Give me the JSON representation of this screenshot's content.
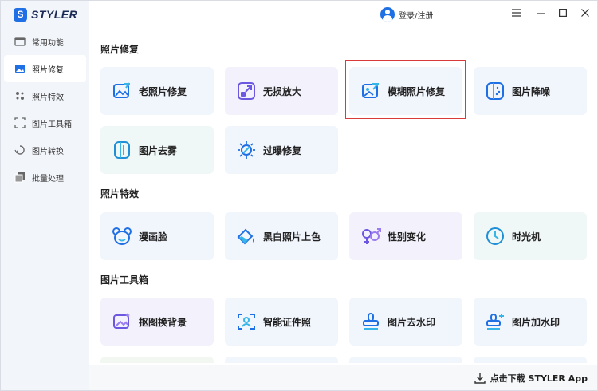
{
  "app": {
    "brand_mark": "S",
    "brand_name": "STYLER"
  },
  "titlebar": {
    "login_label": "登录/注册",
    "controls": [
      {
        "name": "menu-button",
        "glyph": "☰"
      },
      {
        "name": "minimize-button",
        "glyph": "—"
      },
      {
        "name": "maximize-button",
        "glyph": "☐"
      },
      {
        "name": "close-button",
        "glyph": "✕"
      }
    ]
  },
  "sidebar": {
    "items": [
      {
        "label": "常用功能",
        "icon": "window-icon",
        "active": false
      },
      {
        "label": "照片修复",
        "icon": "image-icon",
        "active": true
      },
      {
        "label": "照片特效",
        "icon": "sparkle-icon",
        "active": false
      },
      {
        "label": "图片工具箱",
        "icon": "toolbox-icon",
        "active": false
      },
      {
        "label": "图片转换",
        "icon": "convert-icon",
        "active": false
      },
      {
        "label": "批量处理",
        "icon": "batch-icon",
        "active": false
      }
    ]
  },
  "sections": {
    "repair": {
      "title": "照片修复",
      "cards": [
        {
          "label": "老照片修复",
          "icon": "old-photo-icon"
        },
        {
          "label": "无损放大",
          "icon": "enlarge-icon"
        },
        {
          "label": "模糊照片修复",
          "icon": "blur-repair-icon"
        },
        {
          "label": "图片降噪",
          "icon": "denoise-icon"
        },
        {
          "label": "图片去雾",
          "icon": "dehaze-icon"
        },
        {
          "label": "过曝修复",
          "icon": "overexposure-icon"
        }
      ]
    },
    "effects": {
      "title": "照片特效",
      "cards": [
        {
          "label": "漫画脸",
          "icon": "cartoon-face-icon"
        },
        {
          "label": "黑白照片上色",
          "icon": "colorize-icon"
        },
        {
          "label": "性别变化",
          "icon": "gender-icon"
        },
        {
          "label": "时光机",
          "icon": "clock-icon"
        }
      ]
    },
    "toolbox": {
      "title": "图片工具箱",
      "cards": [
        {
          "label": "抠图换背景",
          "icon": "cutout-icon"
        },
        {
          "label": "智能证件照",
          "icon": "id-photo-icon"
        },
        {
          "label": "图片去水印",
          "icon": "remove-watermark-icon"
        },
        {
          "label": "图片加水印",
          "icon": "add-watermark-icon"
        }
      ]
    }
  },
  "bottombar": {
    "download_label": "点击下载 STYLER App"
  },
  "colors": {
    "accent": "#1f6fe5",
    "highlight": "#d93b3b"
  }
}
